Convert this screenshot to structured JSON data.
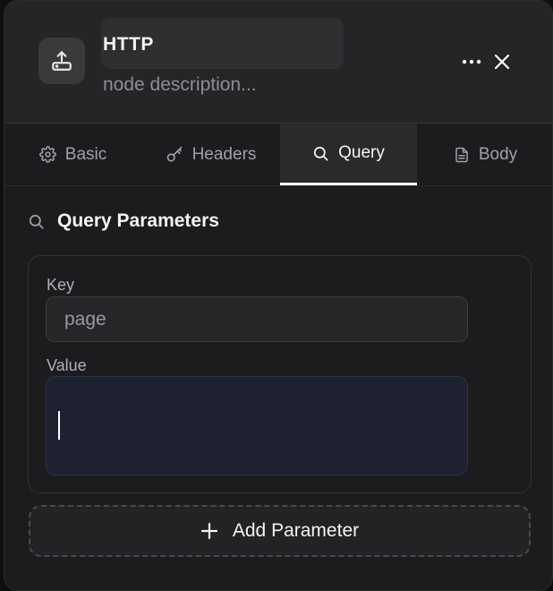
{
  "node": {
    "icon": "upload-tray-icon",
    "title": "HTTP",
    "description_placeholder": "node description..."
  },
  "header_actions": {
    "more_icon": "more-horizontal-icon",
    "close_icon": "close-icon"
  },
  "tabs": [
    {
      "label": "Basic",
      "icon": "gear-icon",
      "active": false
    },
    {
      "label": "Headers",
      "icon": "key-icon",
      "active": false
    },
    {
      "label": "Query",
      "icon": "search-icon",
      "active": true
    },
    {
      "label": "Body",
      "icon": "document-icon",
      "active": false
    }
  ],
  "query": {
    "section_title": "Query Parameters",
    "section_icon": "search-icon",
    "params": [
      {
        "key_label": "Key",
        "key_value": "page",
        "value_label": "Value",
        "value_value": ""
      }
    ],
    "add_button_label": "Add Parameter",
    "add_button_icon": "plus-icon"
  },
  "colors": {
    "panel_bg": "#1c1c1e",
    "header_bg": "#252527",
    "active_tab_indicator": "#ffffff",
    "focused_input_bg": "#1d2130",
    "focused_input_border": "#2c3550"
  }
}
